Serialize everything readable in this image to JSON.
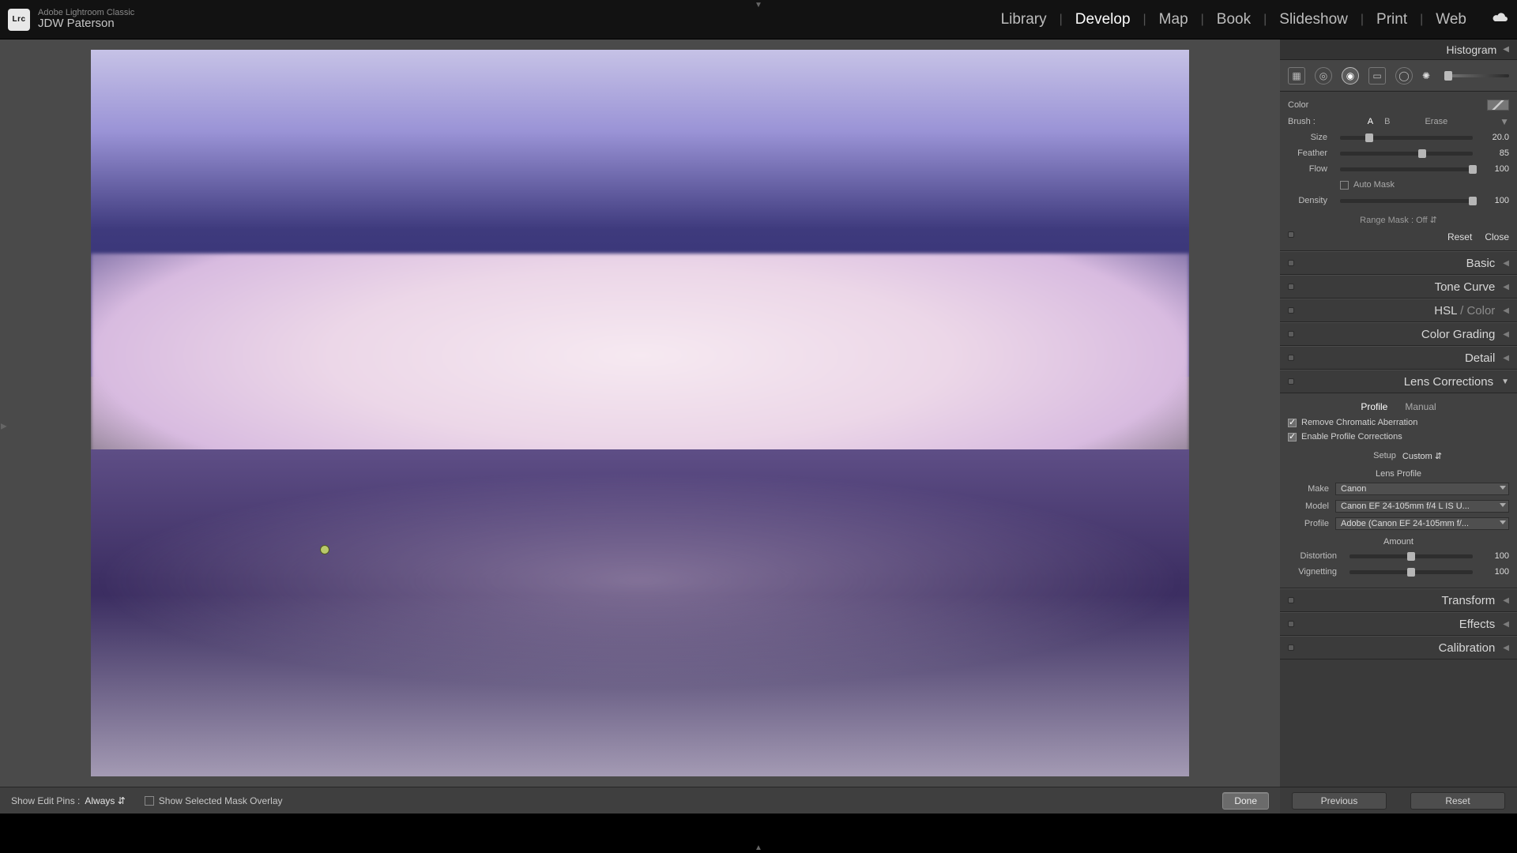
{
  "app": {
    "name": "Adobe Lightroom Classic",
    "logo_text": "Lrc",
    "user": "JDW Paterson"
  },
  "modules": [
    "Library",
    "Develop",
    "Map",
    "Book",
    "Slideshow",
    "Print",
    "Web"
  ],
  "active_module": "Develop",
  "histogram_label": "Histogram",
  "brush": {
    "color_label": "Color",
    "brush_label": "Brush :",
    "options": {
      "a": "A",
      "b": "B",
      "erase": "Erase",
      "selected": "A"
    },
    "size": {
      "label": "Size",
      "value": "20.0",
      "pct": 22
    },
    "feather": {
      "label": "Feather",
      "value": "85",
      "pct": 62
    },
    "flow": {
      "label": "Flow",
      "value": "100",
      "pct": 100
    },
    "auto_mask_label": "Auto Mask",
    "density": {
      "label": "Density",
      "value": "100",
      "pct": 100
    },
    "range_mask": "Range Mask : Off  ⇵",
    "reset": "Reset",
    "close": "Close"
  },
  "sections": {
    "basic": "Basic",
    "tone_curve": "Tone Curve",
    "hsl": "HSL",
    "color_word": "Color",
    "color_grading": "Color Grading",
    "detail": "Detail",
    "lens_corrections": "Lens Corrections",
    "transform": "Transform",
    "effects": "Effects",
    "calibration": "Calibration"
  },
  "lens": {
    "tabs": {
      "profile": "Profile",
      "manual": "Manual",
      "selected": "Profile"
    },
    "remove_ca": "Remove Chromatic Aberration",
    "enable_profile": "Enable Profile Corrections",
    "setup_label": "Setup",
    "setup_value": "Custom   ⇵",
    "lens_profile_hdr": "Lens Profile",
    "make": {
      "label": "Make",
      "value": "Canon"
    },
    "model": {
      "label": "Model",
      "value": "Canon EF 24-105mm f/4 L IS U..."
    },
    "profile": {
      "label": "Profile",
      "value": "Adobe (Canon EF 24-105mm f/..."
    },
    "amount_hdr": "Amount",
    "distortion": {
      "label": "Distortion",
      "value": "100",
      "pct": 50
    },
    "vignetting": {
      "label": "Vignetting",
      "value": "100",
      "pct": 50
    }
  },
  "canvas_bar": {
    "pins_label": "Show Edit Pins :",
    "pins_value": "Always   ⇵",
    "overlay_label": "Show Selected Mask Overlay",
    "done": "Done"
  },
  "nav_buttons": {
    "previous": "Previous",
    "reset": "Reset"
  }
}
